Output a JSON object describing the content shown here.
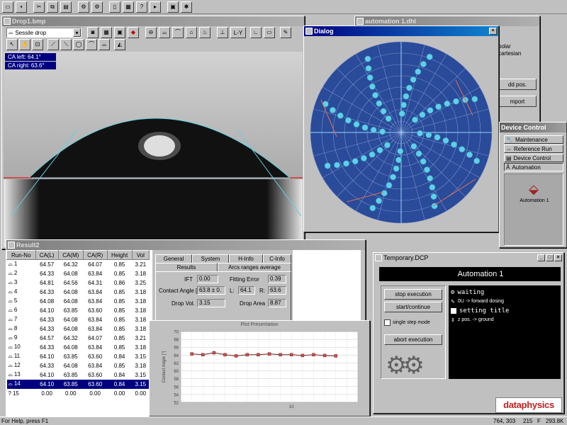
{
  "app": {
    "status_text": "For Help, press F1",
    "status_coords": "764, 303",
    "status_num": "215",
    "status_f": "F",
    "status_mem": "293.8K",
    "brand": "dataphysics"
  },
  "toolbar_main": {
    "icons": [
      "new-icon",
      "save-icon",
      "cut-icon",
      "copy-icon",
      "paste-icon",
      "print-icon",
      "settings-icon",
      "help-icon"
    ]
  },
  "drop_window": {
    "title": "Drop1.bmp",
    "method": "Sessile drop",
    "ca_left": "CA left:  64.1°",
    "ca_right": "CA right: 63.6°",
    "toolbar_btn_ly": "L-Y"
  },
  "automation_window": {
    "title": "automation 1.dhl",
    "side_texts": [
      "polar",
      "cartesian",
      "dd pos.",
      "mport"
    ]
  },
  "dialog_window": {
    "title": "Dialog"
  },
  "device_control": {
    "title": "Device Control",
    "items": [
      {
        "label": "Maintenance"
      },
      {
        "label": "Reference Run"
      },
      {
        "label": "Device Control"
      },
      {
        "label": "Automation"
      }
    ],
    "automation_label": "Automation 1"
  },
  "result_window": {
    "title": "Result2",
    "columns": [
      "Run-No",
      "CA(L)",
      "CA(M)",
      "CA(R)",
      "Height",
      "Vol"
    ],
    "rows": [
      [
        "1",
        "64.57",
        "64.32",
        "64.07",
        "0.85",
        "3.21"
      ],
      [
        "2",
        "64.33",
        "64.08",
        "63.84",
        "0.85",
        "3.18"
      ],
      [
        "3",
        "64.81",
        "64.56",
        "64.31",
        "0.86",
        "3.25"
      ],
      [
        "4",
        "64.33",
        "64.08",
        "63.84",
        "0.85",
        "3.18"
      ],
      [
        "5",
        "64.08",
        "64.08",
        "63.84",
        "0.85",
        "3.18"
      ],
      [
        "6",
        "64.10",
        "63.85",
        "63.60",
        "0.85",
        "3.18"
      ],
      [
        "7",
        "64.33",
        "64.08",
        "63.84",
        "0.85",
        "3.18"
      ],
      [
        "8",
        "64.33",
        "64.08",
        "63.84",
        "0.85",
        "3.18"
      ],
      [
        "9",
        "64.57",
        "64.32",
        "64.07",
        "0.85",
        "3.21"
      ],
      [
        "10",
        "64.33",
        "64.08",
        "63.84",
        "0.85",
        "3.18"
      ],
      [
        "11",
        "64.10",
        "63.85",
        "63.60",
        "0.84",
        "3.15"
      ],
      [
        "12",
        "64.33",
        "64.08",
        "63.84",
        "0.85",
        "3.18"
      ],
      [
        "13",
        "64.10",
        "63.85",
        "63.60",
        "0.84",
        "3.15"
      ],
      [
        "14",
        "64.10",
        "63.85",
        "63.60",
        "0.84",
        "3.15"
      ],
      [
        "15",
        "0.00",
        "0.00",
        "0.00",
        "0.00",
        "0.00"
      ]
    ],
    "selected_row": 13,
    "tabs_row1": [
      "General",
      "System",
      "H-Info",
      "C-Info"
    ],
    "tabs_row2": [
      "Results",
      "Arcs ranges average"
    ],
    "fields": {
      "ift_label": "IFT",
      "ift_value": "0.00",
      "fitting_label": "Fitting Error",
      "fitting_value": "0.39",
      "ca_label": "Contact Angle [°",
      "ca_value": "63.8 ± 0.",
      "l_label": "L:",
      "l_value": "64.1",
      "r_label": "R:",
      "r_value": "63.6",
      "vol_label": "Drop Vol.",
      "vol_value": "3.15",
      "area_label": "Drop Area",
      "area_value": "8.87"
    }
  },
  "plot_window": {
    "title": "Plot Presentation",
    "y_axis_label": "Contact Angle [°]",
    "y_ticks": [
      "70",
      "68",
      "66",
      "64",
      "62",
      "60",
      "58",
      "56",
      "54",
      "52"
    ],
    "x_ticks": [
      "10"
    ]
  },
  "chart_data": {
    "type": "line",
    "title": "Plot Presentation",
    "ylabel": "Contact Angle [°]",
    "ylim": [
      52,
      70
    ],
    "x": [
      1,
      2,
      3,
      4,
      5,
      6,
      7,
      8,
      9,
      10,
      11,
      12,
      13,
      14
    ],
    "series": [
      {
        "values": [
          64.3,
          64.1,
          64.6,
          64.1,
          63.8,
          64.1,
          64.1,
          64.3,
          64.1,
          64.1,
          63.9,
          64.1,
          63.9,
          63.8
        ]
      }
    ],
    "x_ticks": [
      10
    ],
    "grid": true
  },
  "temp_window": {
    "title": "Temporary.DCP",
    "header": "Automation 1",
    "buttons": [
      "stop execution",
      "start/continue",
      "single step mode",
      "abort execution"
    ],
    "steps": [
      "waiting",
      "0U -> forward dosing",
      "setting title",
      "z pos. -> ground"
    ]
  }
}
